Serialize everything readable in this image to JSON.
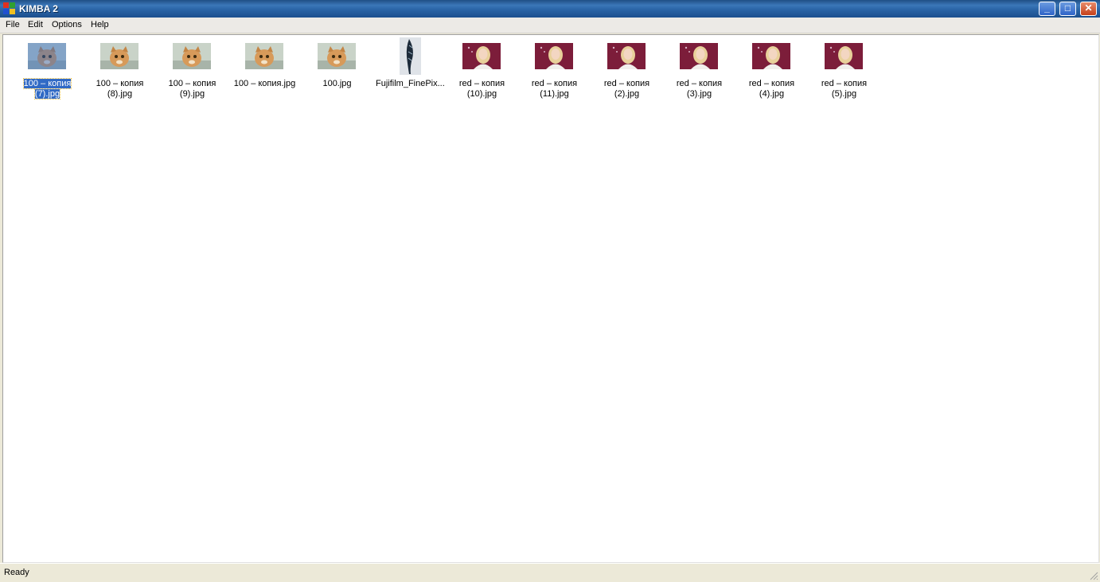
{
  "window": {
    "title": "KIMBA 2"
  },
  "menu": [
    "File",
    "Edit",
    "Options",
    "Help"
  ],
  "controls": {
    "minimize": "_",
    "maximize": "□",
    "close": "✕"
  },
  "files": [
    {
      "name": "100 – копия (7).jpg",
      "line1": "100 – копия",
      "line2": "(7).jpg",
      "kind": "cat",
      "selected": true
    },
    {
      "name": "100 – копия (8).jpg",
      "line1": "100 – копия",
      "line2": "(8).jpg",
      "kind": "cat"
    },
    {
      "name": "100 – копия (9).jpg",
      "line1": "100 – копия",
      "line2": "(9).jpg",
      "kind": "cat"
    },
    {
      "name": "100 – копия.jpg",
      "line1": "100 – копия.jpg",
      "line2": "",
      "kind": "cat"
    },
    {
      "name": "100.jpg",
      "line1": "100.jpg",
      "line2": "",
      "kind": "cat"
    },
    {
      "name": "Fujifilm_FinePix...",
      "line1": "Fujifilm_FinePix...",
      "line2": "",
      "kind": "feather"
    },
    {
      "name": "red – копия (10).jpg",
      "line1": "red – копия",
      "line2": "(10).jpg",
      "kind": "girl"
    },
    {
      "name": "red – копия (11).jpg",
      "line1": "red – копия",
      "line2": "(11).jpg",
      "kind": "girl"
    },
    {
      "name": "red – копия (2).jpg",
      "line1": "red – копия",
      "line2": "(2).jpg",
      "kind": "girl"
    },
    {
      "name": "red – копия (3).jpg",
      "line1": "red – копия",
      "line2": "(3).jpg",
      "kind": "girl"
    },
    {
      "name": "red – копия (4).jpg",
      "line1": "red – копия",
      "line2": "(4).jpg",
      "kind": "girl"
    },
    {
      "name": "red – копия (5).jpg",
      "line1": "red – копия",
      "line2": "(5).jpg",
      "kind": "girl"
    }
  ],
  "status": {
    "text": "Ready"
  },
  "colors": {
    "selection": "#316ac5",
    "titlebar": "#2a64a6"
  }
}
